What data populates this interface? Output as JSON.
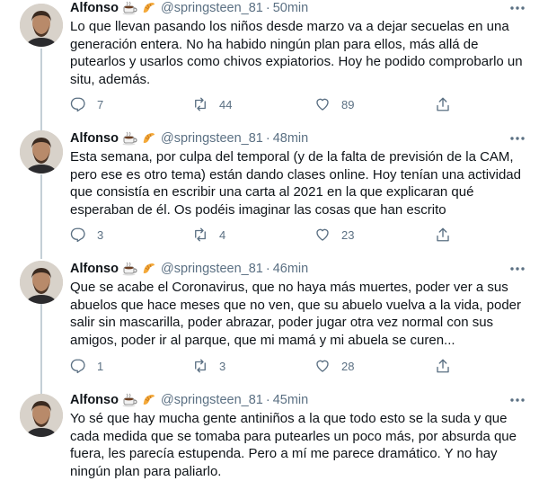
{
  "tweets": [
    {
      "author": "Alfonso",
      "handle": "@springsteen_81",
      "separator": "·",
      "time": "50min",
      "text": "Lo que llevan pasando los niños desde marzo va a dejar secuelas en una generación entera. No ha habido ningún plan para ellos, más allá de putearlos y usarlos como chivos expiatorios. Hoy he podido comprobarlo un situ, además.",
      "replies": "7",
      "retweets": "44",
      "likes": "89"
    },
    {
      "author": "Alfonso",
      "handle": "@springsteen_81",
      "separator": "·",
      "time": "48min",
      "text": "Esta semana, por culpa del temporal (y de la falta de previsión de la CAM, pero ese es otro tema) están dando clases online. Hoy tenían una actividad que consistía en escribir una carta al 2021 en la que explicaran qué esperaban de él. Os podéis imaginar las cosas que han escrito",
      "replies": "3",
      "retweets": "4",
      "likes": "23"
    },
    {
      "author": "Alfonso",
      "handle": "@springsteen_81",
      "separator": "·",
      "time": "46min",
      "text": "Que se acabe el Coronavirus, que no haya más muertes, poder ver a sus abuelos que hace meses que no ven, que su abuelo vuelva a la vida, poder salir sin mascarilla, poder abrazar, poder jugar otra vez normal con sus amigos, poder ir al parque, que mi mamá y mi abuela se curen...",
      "replies": "1",
      "retweets": "3",
      "likes": "28"
    },
    {
      "author": "Alfonso",
      "handle": "@springsteen_81",
      "separator": "·",
      "time": "45min",
      "text": "Yo sé que hay mucha gente antiniños a la que todo esto se la suda y que cada medida que se tomaba para putearles un poco más, por absurda que fuera, les parecía estupenda. Pero a mí me parece dramático. Y no hay ningún plan para paliarlo."
    }
  ],
  "icons": {
    "name_emoji_1": "coffee-cup-icon",
    "name_emoji_2": "croissant-icon",
    "more": "more-options-icon",
    "reply": "reply-icon",
    "retweet": "retweet-icon",
    "like": "heart-icon",
    "share": "share-icon"
  },
  "colors": {
    "text": "#0f1419",
    "secondary": "#5b7083",
    "thread_line": "#c4cfd6",
    "divider": "#e6ecf0"
  }
}
